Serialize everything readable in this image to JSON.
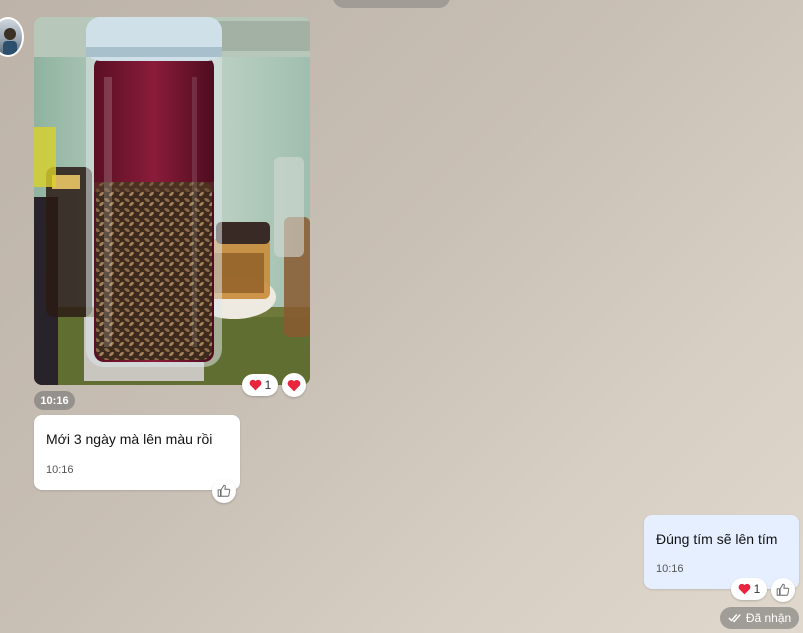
{
  "messages": [
    {
      "type": "image",
      "direction": "incoming",
      "time": "10:16",
      "reactions": {
        "heart_count": "1"
      }
    },
    {
      "type": "text",
      "direction": "incoming",
      "text": "Mới 3 ngày mà lên màu rồi",
      "time": "10:16"
    },
    {
      "type": "text",
      "direction": "outgoing",
      "text": "Đúng tím sẽ lên tím",
      "time": "10:16",
      "reactions": {
        "heart_count": "1"
      },
      "status": "Đã nhận"
    }
  ],
  "icons": {
    "heart": "heart-icon",
    "like": "thumbs-up-icon",
    "check": "double-check-icon"
  },
  "colors": {
    "heart": "#e8253c",
    "outgoing_bubble": "#e5efff",
    "incoming_bubble": "#ffffff"
  }
}
